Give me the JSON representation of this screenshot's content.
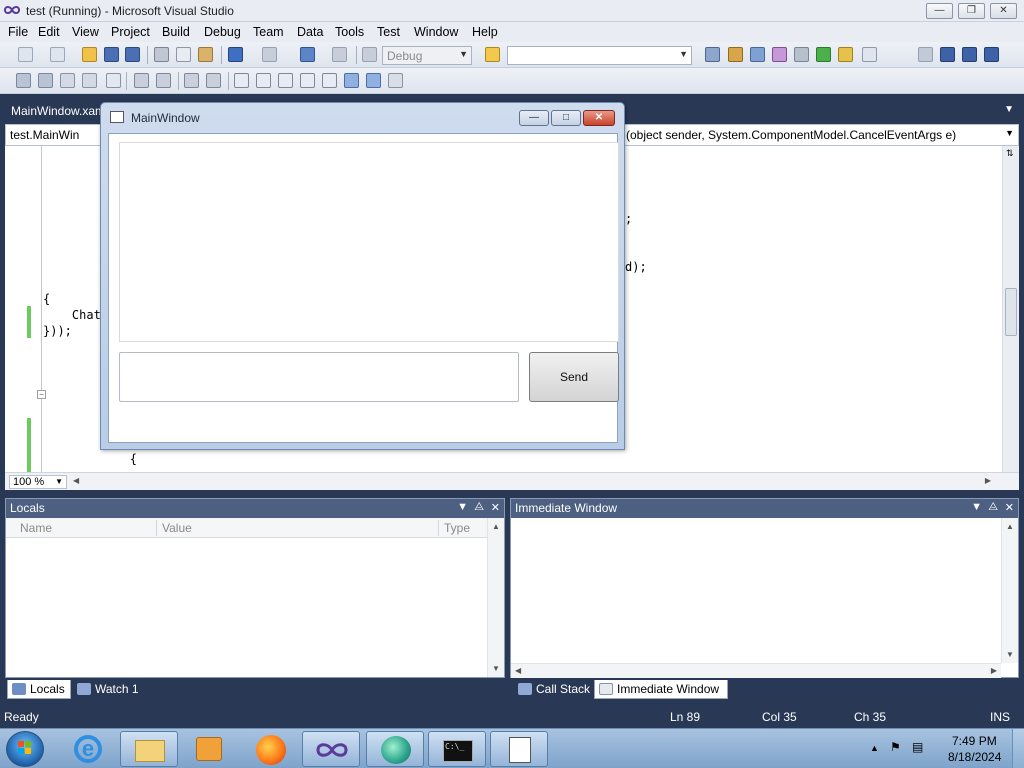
{
  "window": {
    "title": "test (Running) - Microsoft Visual Studio"
  },
  "menu": [
    "File",
    "Edit",
    "View",
    "Project",
    "Build",
    "Debug",
    "Team",
    "Data",
    "Tools",
    "Test",
    "Window",
    "Help"
  ],
  "toolbar": {
    "config_combo": "Debug",
    "find_combo": ""
  },
  "document": {
    "tab": "MainWindow.xam",
    "nav_left": "test.MainWin",
    "nav_right": "(object sender, System.ComponentModel.CancelEventArgs e)",
    "code_lines": {
      "l1": ";",
      "l2": "d);",
      "l3": "{",
      "l4": "    Chat",
      "l5": "}));",
      "l6": "            {"
    },
    "zoom": "100 %"
  },
  "main_window": {
    "title": "MainWindow",
    "send_label": "Send",
    "message_value": ""
  },
  "locals": {
    "title": "Locals",
    "columns": [
      "Name",
      "Value",
      "Type"
    ]
  },
  "immediate": {
    "title": "Immediate Window"
  },
  "bottom_tabs_left": [
    "Locals",
    "Watch 1"
  ],
  "bottom_tabs_right": [
    "Call Stack",
    "Immediate Window"
  ],
  "status": {
    "text": "Ready",
    "ln": "Ln 89",
    "col": "Col 35",
    "ch": "Ch 35",
    "mode": "INS"
  },
  "clock": {
    "time": "7:49 PM",
    "date": "8/18/2024"
  }
}
